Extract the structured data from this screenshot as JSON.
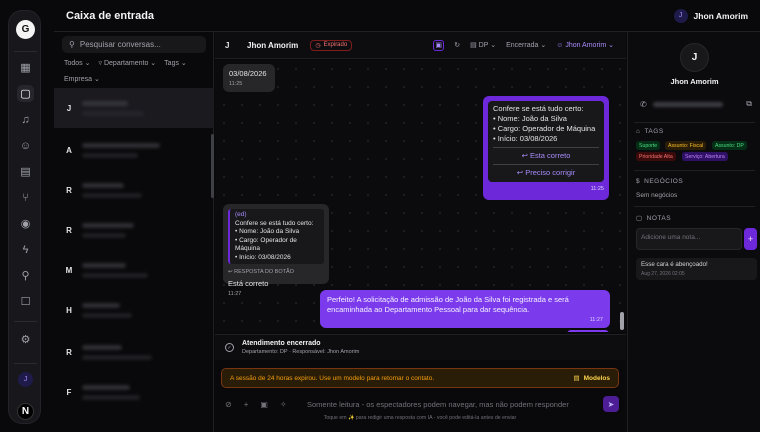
{
  "rail": {
    "logo": "G",
    "user_initial": "J",
    "bottom_badge": "N"
  },
  "topbar": {
    "title": "Caixa de entrada",
    "user_initial": "J",
    "user_name": "Jhon Amorim"
  },
  "list": {
    "search_placeholder": "Pesquisar conversas...",
    "filters": [
      "Todos",
      "Departamento",
      "Tags"
    ],
    "filter_company": "Empresa",
    "initials": [
      "J",
      "A",
      "R",
      "R",
      "M",
      "H",
      "R",
      "F"
    ]
  },
  "chat": {
    "contact_initial": "J",
    "contact_name": "Jhon Amorim",
    "status_badge": "Expirado",
    "department": "DP",
    "status_select": "Encerrada",
    "assignee": "Jhon Amorim",
    "messages": {
      "date_text": "03/08/2026",
      "date_time": "11:25",
      "confirm_title": "Confere se está tudo certo:",
      "confirm_name": "• Nome: João da Silva",
      "confirm_role": "• Cargo: Operador de Máquina",
      "confirm_start": "• Início: 03/08/2026",
      "btn_ok": "Esta correto",
      "btn_fix": "Preciso corrigir",
      "confirm_time": "11:25",
      "reply_quote_label": "(ed)",
      "reply_quote_title": "Confere se está tudo certo:",
      "reply_quote_name": "• Nome: João da Silva",
      "reply_quote_role": "• Cargo: Operador de Máquina",
      "reply_quote_start": "• Início: 03/08/2026",
      "reply_tag": "RESPOSTA DO BOTÃO",
      "reply_text": "Está correto",
      "reply_time": "11:27",
      "final_text": "Perfeito! A solicitação de admissão de João da Silva foi registrada e será encaminhada ao Departamento Pessoal para dar sequência.",
      "final_time": "11:27"
    },
    "closed_title": "Atendimento encerrado",
    "closed_sub": "Departamento: DP · Responsável: Jhon Amorim",
    "warning_text": "A sessão de 24 horas expirou. Use um modelo para retomar o contato.",
    "warning_button": "Modelos",
    "composer_placeholder": "Somente leitura - os espectadores podem navegar, mas não podem responder",
    "hint": "Toque em ✨ para redigir uma resposta com IA - você pode editá-la antes de enviar"
  },
  "details": {
    "initial": "J",
    "name": "Jhon Amorim",
    "tags_label": "TAGS",
    "tags": [
      "Suporte",
      "Assunto: Fiscal",
      "Assunto: DP",
      "Prioridade Alta",
      "Serviço: Abertura"
    ],
    "deals_label": "NEGÓCIOS",
    "deals_none": "Sem negócios",
    "notes_label": "NOTAS",
    "note_placeholder": "Adicione uma nota...",
    "note_text": "Esse cara é abençoado!",
    "note_date": "Aug 27, 2026 02:05"
  }
}
